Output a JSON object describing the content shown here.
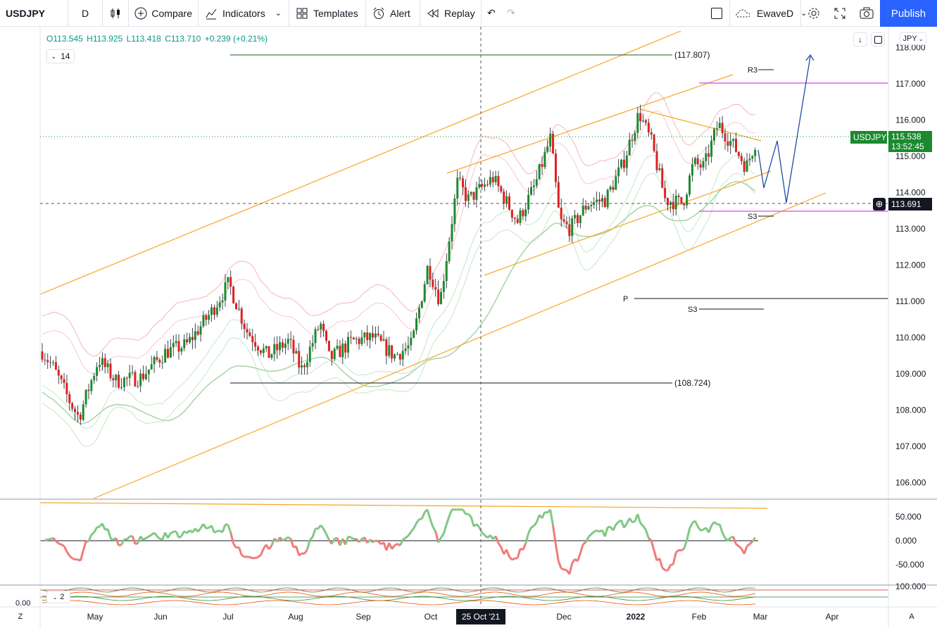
{
  "toolbar": {
    "symbol": "USDJPY",
    "interval": "D",
    "compare": "Compare",
    "indicators": "Indicators",
    "templates": "Templates",
    "alert": "Alert",
    "replay": "Replay",
    "layout_name": "EwaveD",
    "publish": "Publish"
  },
  "legend": {
    "open": "O113.545",
    "high": "H113.925",
    "low": "L113.418",
    "close": "C113.710",
    "change": "+0.239 (+0.21%)",
    "length": "14"
  },
  "price_axis": {
    "currency": "JPY",
    "ticks": [
      "118.000",
      "117.000",
      "116.000",
      "115.000",
      "114.000",
      "113.000",
      "112.000",
      "111.000",
      "110.000",
      "109.000",
      "108.000",
      "107.000",
      "106.000"
    ],
    "symbol_tag": "USDJPY",
    "last_price": "115.538",
    "countdown": "13:52:45",
    "crosshair_price": "113.691"
  },
  "osc_axis": {
    "ticks": [
      "50.000",
      "0.000",
      "-50.000"
    ],
    "ticks2": [
      "100.000"
    ],
    "left_value": "0.00",
    "pane2_len": "2"
  },
  "time_axis": {
    "labels": [
      "May",
      "Jun",
      "Jul",
      "Aug",
      "Sep",
      "Oct",
      "Dec",
      "2022",
      "Feb",
      "Mar",
      "Apr"
    ],
    "crosshair_date": "25 Oct '21",
    "left_btn": "Z",
    "right_btn": "A"
  },
  "annotations": {
    "level_high": "(117.807)",
    "level_low": "(108.724)",
    "r3": "R3",
    "s3_a": "S3",
    "p": "P",
    "s3_b": "S3"
  },
  "colors": {
    "up": "#089981",
    "down": "#f23645",
    "candle_up": "#1b8a2e",
    "candle_down": "#e02020",
    "channel": "#f5a623",
    "accent": "#2962ff",
    "magenta": "#e040fb"
  }
}
